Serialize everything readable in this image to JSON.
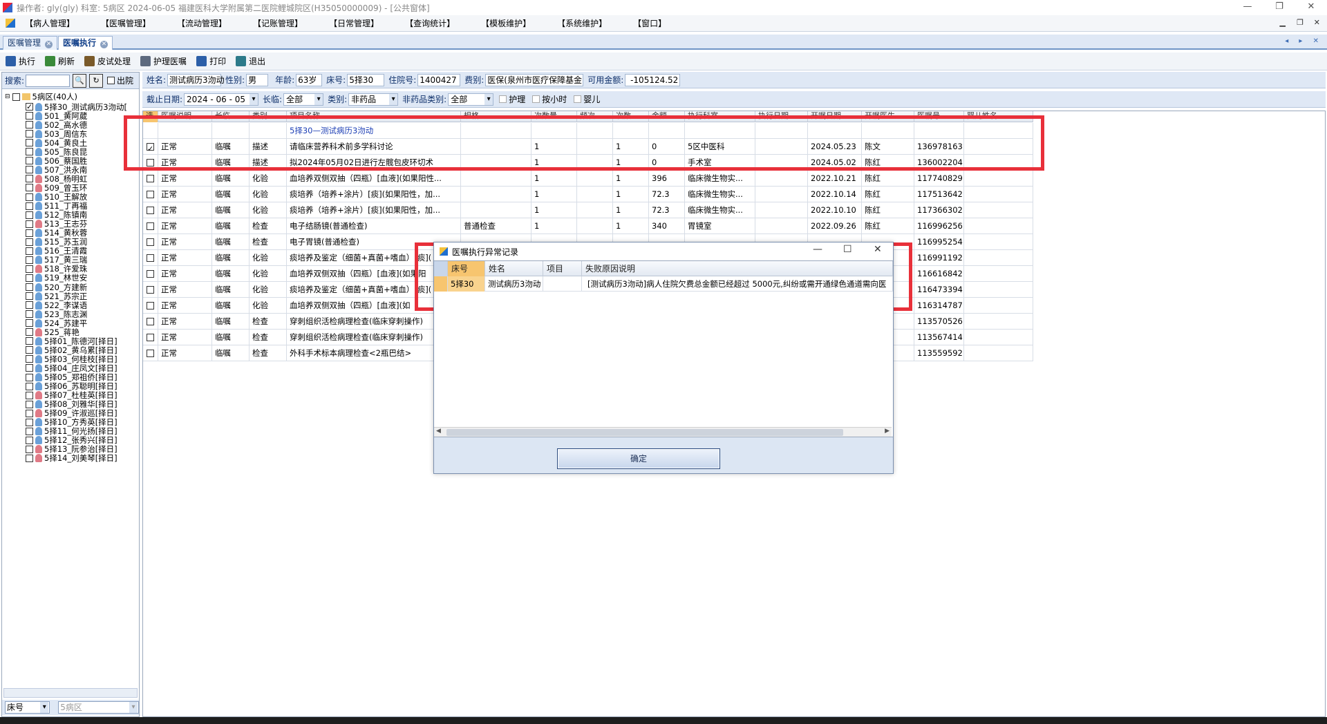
{
  "titlebar": {
    "text": "操作者: gly(gly)  科室: 5病区  2024-06-05  福建医科大学附属第二医院鲤城院区(H35050000009) - [公共窗体]"
  },
  "menu": [
    "【病人管理】",
    "【医嘱管理】",
    "【流动管理】",
    "【记账管理】",
    "【日常管理】",
    "【查询统计】",
    "【模板维护】",
    "【系统维护】",
    "【窗口】"
  ],
  "tabs": [
    {
      "label": "医嘱管理"
    },
    {
      "label": "医嘱执行"
    }
  ],
  "toolbar": [
    {
      "label": "执行",
      "icon": "execute-icon"
    },
    {
      "label": "刷新",
      "icon": "refresh-icon"
    },
    {
      "label": "皮试处理",
      "icon": "skin-test-icon"
    },
    {
      "label": "护理医嘱",
      "icon": "nursing-order-icon"
    },
    {
      "label": "打印",
      "icon": "print-icon"
    },
    {
      "label": "退出",
      "icon": "exit-icon"
    }
  ],
  "left": {
    "search_label": "搜索:",
    "discharge_label": "出院",
    "root": "5病区(40人)",
    "patients": [
      "5择30_测试病历3沕动[",
      "501_黄阿葳",
      "502_高水德",
      "503_周信东",
      "504_黄良土",
      "505_陈良昆",
      "506_蔡国胜",
      "507_洪永南",
      "508_杨明虹",
      "509_曾玉环",
      "510_王解放",
      "511_丁再福",
      "512_陈镇南",
      "513_王志芬",
      "514_黄秋蓉",
      "515_苏玉润",
      "516_王清霞",
      "517_黄三瑞",
      "518_许爱珠",
      "519_林世安",
      "520_方建新",
      "521_苏宗正",
      "522_李谋语",
      "523_陈志渊",
      "524_苏建平",
      "525_蒋艳",
      "5择01_陈德河[择日]",
      "5择02_黄乌累[择日]",
      "5择03_何桂枝[择日]",
      "5择04_庄凤文[择日]",
      "5择05_郑祖侨[择日]",
      "5择06_苏聪明[择日]",
      "5择07_杜桂英[择日]",
      "5择08_刘雅华[择日]",
      "5择09_许淑巡[择日]",
      "5择10_方秀英[择日]",
      "5择11_何光扬[择日]",
      "5择12_张秀兴[择日]",
      "5择13_阮参治[择日]",
      "5择14_刘美琴[择日]"
    ],
    "female": [
      8,
      9,
      13,
      18,
      25,
      32,
      34,
      38,
      39
    ],
    "footer_sort": "床号",
    "footer_ward": "5病区"
  },
  "info": {
    "name_label": "姓名:",
    "name": "测试病历3沕动",
    "sex_label": "性别:",
    "sex": "男",
    "age_label": "年龄:",
    "age": "63岁",
    "bed_label": "床号:",
    "bed": "5择30",
    "inpatient_label": "住院号:",
    "inpatient_no": "1400427",
    "fee_label": "费别:",
    "fee_type": "医保(泉州市医疗保障基金",
    "balance_label": "可用金额:",
    "balance": "-105124.52"
  },
  "filter": {
    "date_label": "截止日期:",
    "date": "2024 - 06 - 05",
    "longterm_label": "长临:",
    "longterm": "全部",
    "category_label": "类别:",
    "category": "非药品",
    "nondrug_label": "非药品类别:",
    "nondrug": "全部",
    "nursing_label": "护理",
    "hourly_label": "按小时",
    "infant_label": "婴儿"
  },
  "grid": {
    "headers": [
      "选",
      "医嘱说明",
      "长临",
      "类别",
      "项目名称",
      "规格",
      "次数量",
      "频次",
      "次数",
      "金额",
      "执行科室",
      "执行日期",
      "开嘱日期",
      "开嘱医生",
      "医嘱号",
      "婴儿姓名"
    ],
    "group_label": "5择30—测试病历3沕动",
    "rows": [
      {
        "checked": true,
        "status": "正常",
        "lt": "临嘱",
        "type": "描述",
        "item": "请临床营养科术前多学科讨论",
        "spec": "",
        "qty": "1",
        "freq": "",
        "times": "1",
        "amount": "0",
        "dept": "5区中医科",
        "exec": "",
        "date": "2024.05.23",
        "doctor": "陈文",
        "no": "136978163"
      },
      {
        "checked": false,
        "status": "正常",
        "lt": "临嘱",
        "type": "描述",
        "item": "拟2024年05月02日进行左髋包皮环切术",
        "spec": "",
        "qty": "1",
        "freq": "",
        "times": "1",
        "amount": "0",
        "dept": "手术室",
        "exec": "",
        "date": "2024.05.02",
        "doctor": "陈红",
        "no": "136002204"
      },
      {
        "checked": false,
        "status": "正常",
        "lt": "临嘱",
        "type": "化验",
        "item": "血培养双侧双抽（四瓶）[血液](如果阳性...",
        "spec": "",
        "qty": "1",
        "freq": "",
        "times": "1",
        "amount": "396",
        "dept": "临床微生物实...",
        "exec": "",
        "date": "2022.10.21",
        "doctor": "陈红",
        "no": "117740829"
      },
      {
        "checked": false,
        "status": "正常",
        "lt": "临嘱",
        "type": "化验",
        "item": "痰培养（培养+涂片）[痰](如果阳性，加...",
        "spec": "",
        "qty": "1",
        "freq": "",
        "times": "1",
        "amount": "72.3",
        "dept": "临床微生物实...",
        "exec": "",
        "date": "2022.10.14",
        "doctor": "陈红",
        "no": "117513642"
      },
      {
        "checked": false,
        "status": "正常",
        "lt": "临嘱",
        "type": "化验",
        "item": "痰培养（培养+涂片）[痰](如果阳性，加...",
        "spec": "",
        "qty": "1",
        "freq": "",
        "times": "1",
        "amount": "72.3",
        "dept": "临床微生物实...",
        "exec": "",
        "date": "2022.10.10",
        "doctor": "陈红",
        "no": "117366302"
      },
      {
        "checked": false,
        "status": "正常",
        "lt": "临嘱",
        "type": "检查",
        "item": "电子结肠镜(普通检查)",
        "spec": "普通检查",
        "qty": "1",
        "freq": "",
        "times": "1",
        "amount": "340",
        "dept": "胃镜室",
        "exec": "",
        "date": "2022.09.26",
        "doctor": "陈红",
        "no": "116996256"
      },
      {
        "checked": false,
        "status": "正常",
        "lt": "临嘱",
        "type": "检查",
        "item": "电子胃镜(普通检查)",
        "spec": "",
        "qty": "",
        "freq": "",
        "times": "",
        "amount": "",
        "dept": "",
        "exec": "",
        "date": "",
        "doctor": "",
        "no": "116995254"
      },
      {
        "checked": false,
        "status": "正常",
        "lt": "临嘱",
        "type": "化验",
        "item": "痰培养及鉴定（细菌+真菌+嗜血）[痰](",
        "spec": "",
        "qty": "",
        "freq": "",
        "times": "",
        "amount": "",
        "dept": "",
        "exec": "",
        "date": "",
        "doctor": "",
        "no": "116991192"
      },
      {
        "checked": false,
        "status": "正常",
        "lt": "临嘱",
        "type": "化验",
        "item": "血培养双侧双抽（四瓶）[血液](如果阳",
        "spec": "",
        "qty": "",
        "freq": "",
        "times": "",
        "amount": "",
        "dept": "",
        "exec": "",
        "date": "",
        "doctor": "",
        "no": "116616842"
      },
      {
        "checked": false,
        "status": "正常",
        "lt": "临嘱",
        "type": "化验",
        "item": "痰培养及鉴定（细菌+真菌+嗜血）[痰](",
        "spec": "",
        "qty": "",
        "freq": "",
        "times": "",
        "amount": "",
        "dept": "",
        "exec": "",
        "date": "",
        "doctor": "",
        "no": "116473394"
      },
      {
        "checked": false,
        "status": "正常",
        "lt": "临嘱",
        "type": "化验",
        "item": "血培养双侧双抽（四瓶）[血液](如",
        "spec": "",
        "qty": "",
        "freq": "",
        "times": "",
        "amount": "",
        "dept": "",
        "exec": "",
        "date": "",
        "doctor": "",
        "no": "116314787"
      },
      {
        "checked": false,
        "status": "正常",
        "lt": "临嘱",
        "type": "检查",
        "item": "穿刺组织活检病理检查(临床穿刺操作)",
        "spec": "",
        "qty": "",
        "freq": "",
        "times": "",
        "amount": "",
        "dept": "",
        "exec": "",
        "date": "",
        "doctor": "",
        "no": "113570526"
      },
      {
        "checked": false,
        "status": "正常",
        "lt": "临嘱",
        "type": "检查",
        "item": "穿刺组织活检病理检查(临床穿刺操作)",
        "spec": "",
        "qty": "",
        "freq": "",
        "times": "",
        "amount": "",
        "dept": "",
        "exec": "",
        "date": "",
        "doctor": "",
        "no": "113567414"
      },
      {
        "checked": false,
        "status": "正常",
        "lt": "临嘱",
        "type": "检查",
        "item": "外科手术标本病理检查<2瓶巴结>",
        "spec": "",
        "qty": "",
        "freq": "",
        "times": "",
        "amount": "",
        "dept": "",
        "exec": "",
        "date": "",
        "doctor": "",
        "no": "113559592"
      }
    ]
  },
  "dialog": {
    "title": "医嘱执行异常记录",
    "headers": [
      "床号",
      "姓名",
      "项目",
      "失败原因说明"
    ],
    "row": {
      "bed": "5择30",
      "name": "测试病历3沕动",
      "item": "",
      "reason": "[测试病历3沕动]病人住院欠费总金额已经超过 5000元,纠纷或需开通绿色通道需向医"
    },
    "ok_label": "确定"
  },
  "colors": {
    "highlight_box": "#e8303a",
    "accent": "#15428b"
  }
}
